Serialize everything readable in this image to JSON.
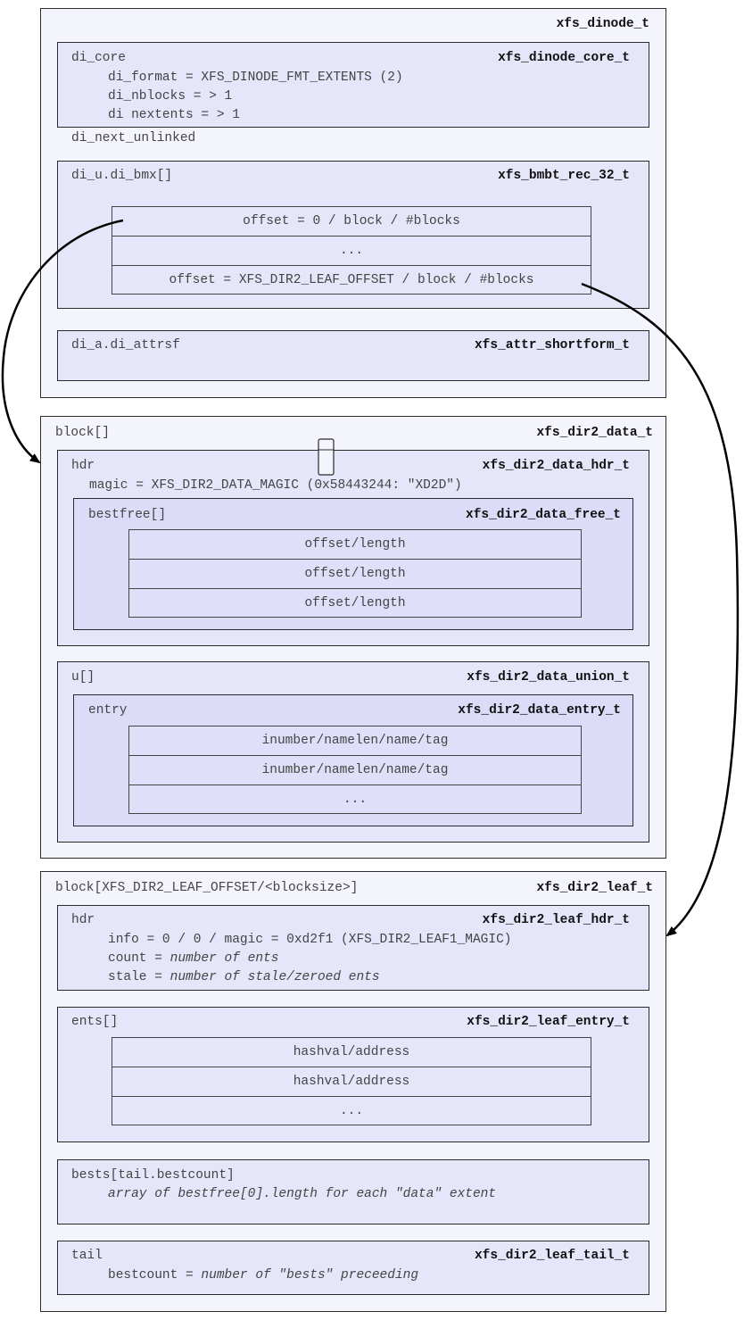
{
  "dinode": {
    "type": "xfs_dinode_t",
    "core": {
      "name": "di_core",
      "type": "xfs_dinode_core_t",
      "lines": [
        "di_format = XFS_DINODE_FMT_EXTENTS (2)",
        "di_nblocks = > 1",
        "di nextents = > 1"
      ]
    },
    "next_unlinked": "di_next_unlinked",
    "bmx": {
      "name": "di_u.di_bmx[]",
      "type": "xfs_bmbt_rec_32_t",
      "rows": [
        "offset = 0 / block / #blocks",
        "...",
        "offset = XFS_DIR2_LEAF_OFFSET / block / #blocks"
      ]
    },
    "attr": {
      "name": "di_a.di_attrsf",
      "type": "xfs_attr_shortform_t"
    }
  },
  "data_block": {
    "name": "block[]",
    "type": "xfs_dir2_data_t",
    "hdr": {
      "name": "hdr",
      "type": "xfs_dir2_data_hdr_t",
      "magic": "magic = XFS_DIR2_DATA_MAGIC (0x58443244: \"XD2D\")",
      "bestfree": {
        "name": "bestfree[]",
        "type": "xfs_dir2_data_free_t",
        "rows": [
          "offset/length",
          "offset/length",
          "offset/length"
        ]
      }
    },
    "u": {
      "name": "u[]",
      "type": "xfs_dir2_data_union_t",
      "entry": {
        "name": "entry",
        "type": "xfs_dir2_data_entry_t",
        "rows": [
          "inumber/namelen/name/tag",
          "inumber/namelen/name/tag",
          "..."
        ]
      }
    }
  },
  "leaf_block": {
    "name": "block[XFS_DIR2_LEAF_OFFSET/<blocksize>]",
    "type": "xfs_dir2_leaf_t",
    "hdr": {
      "name": "hdr",
      "type": "xfs_dir2_leaf_hdr_t",
      "info": "info = 0 / 0 / magic = 0xd2f1 (XFS_DIR2_LEAF1_MAGIC)",
      "count_label": "count = ",
      "count_value": "number of ents",
      "stale_label": "stale = ",
      "stale_value": "number of stale/zeroed ents"
    },
    "ents": {
      "name": "ents[]",
      "type": "xfs_dir2_leaf_entry_t",
      "rows": [
        "hashval/address",
        "hashval/address",
        "..."
      ]
    },
    "bests": {
      "name": "bests[tail.bestcount]",
      "desc": "array of bestfree[0].length for each \"data\" extent"
    },
    "tail": {
      "name": "tail",
      "type": "xfs_dir2_leaf_tail_t",
      "bestcount_label": "bestcount = ",
      "bestcount_value": "number of \"bests\" preceeding"
    }
  }
}
